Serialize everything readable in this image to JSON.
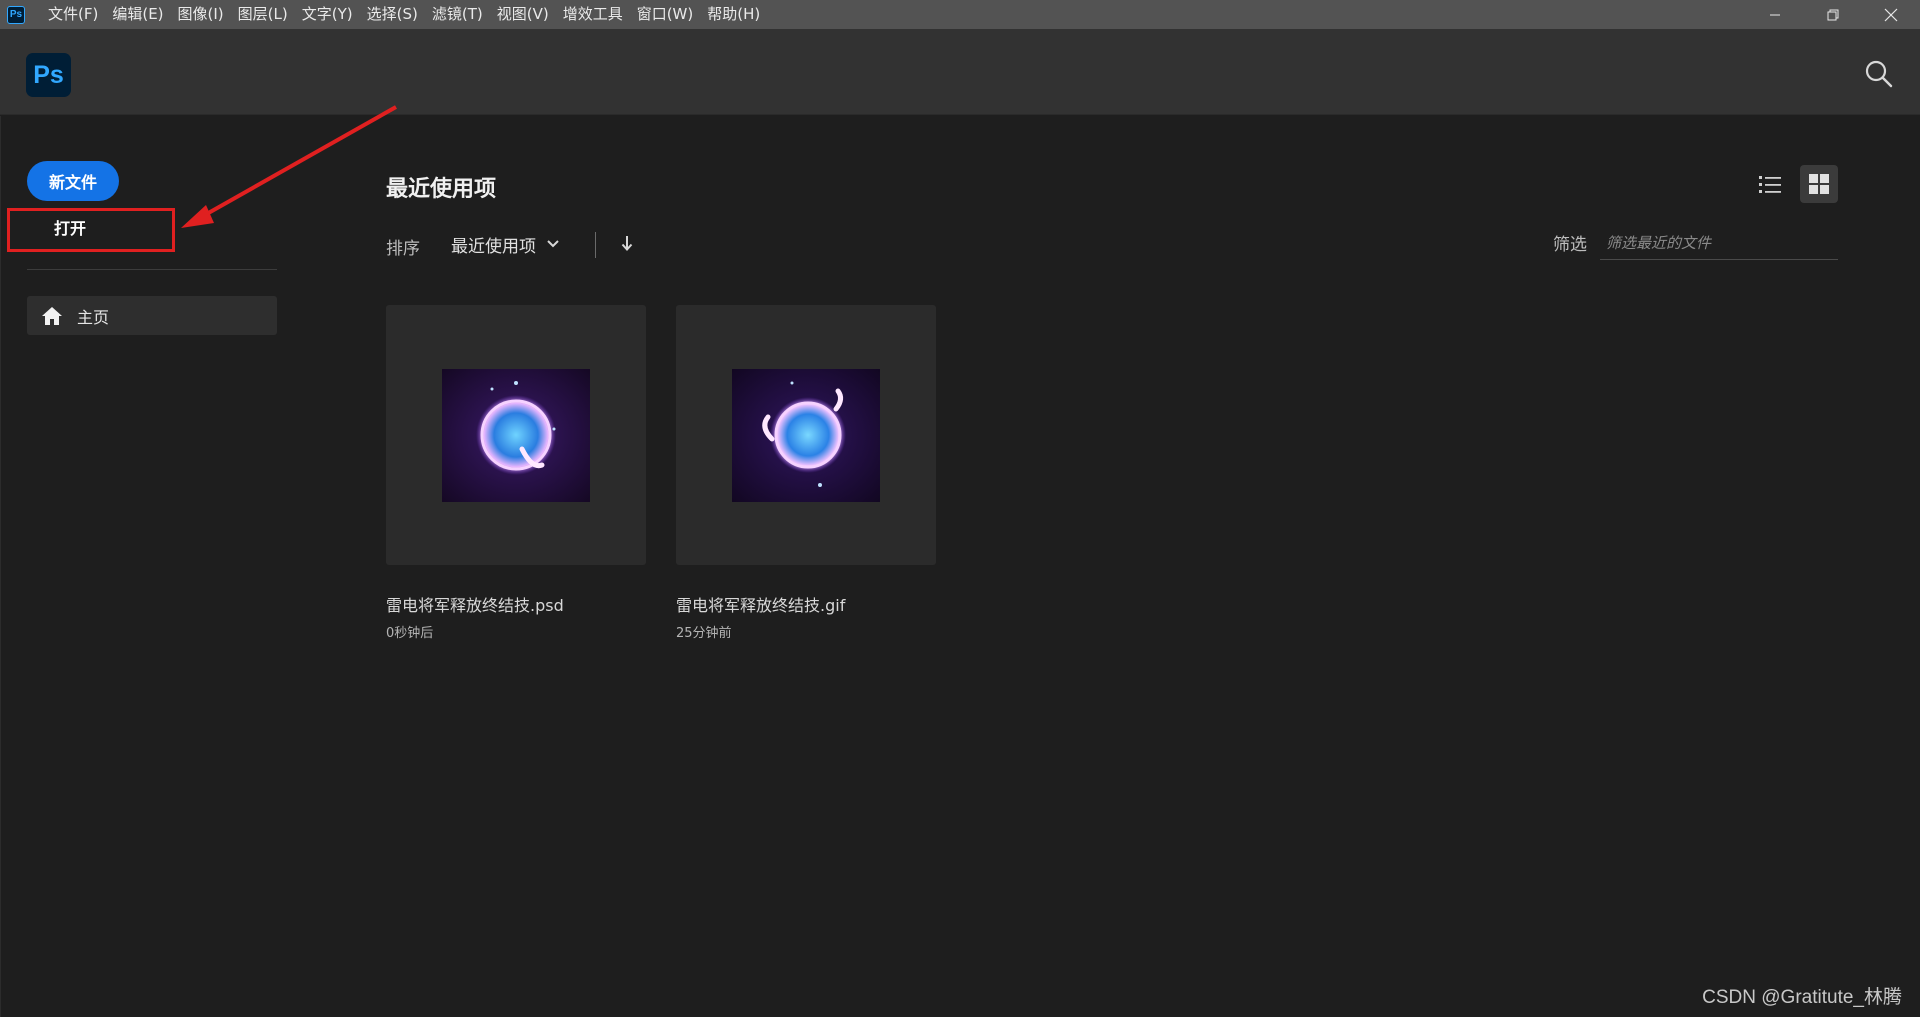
{
  "app": {
    "mini_icon_text": "Ps",
    "logo_text": "Ps"
  },
  "menu": {
    "items": [
      "文件(F)",
      "编辑(E)",
      "图像(I)",
      "图层(L)",
      "文字(Y)",
      "选择(S)",
      "滤镜(T)",
      "视图(V)",
      "增效工具",
      "窗口(W)",
      "帮助(H)"
    ]
  },
  "window_controls": [
    "minimize-icon",
    "restore-icon",
    "close-icon"
  ],
  "sidebar": {
    "new_file_label": "新文件",
    "open_label": "打开",
    "home_label": "主页",
    "home_icon": "home-icon"
  },
  "main": {
    "section_title": "最近使用项",
    "sort_label": "排序",
    "sort_value": "最近使用项",
    "filter_label": "筛选",
    "filter_placeholder": "筛选最近的文件",
    "files": [
      {
        "name": "雷电将军释放终结技.psd",
        "time": "0秒钟后"
      },
      {
        "name": "雷电将军释放终结技.gif",
        "time": "25分钟前"
      }
    ]
  },
  "colors": {
    "accent": "#1473e6",
    "annotation": "#e02020",
    "ps_blue": "#31a8ff"
  },
  "watermark": "CSDN @Gratitute_林腾"
}
